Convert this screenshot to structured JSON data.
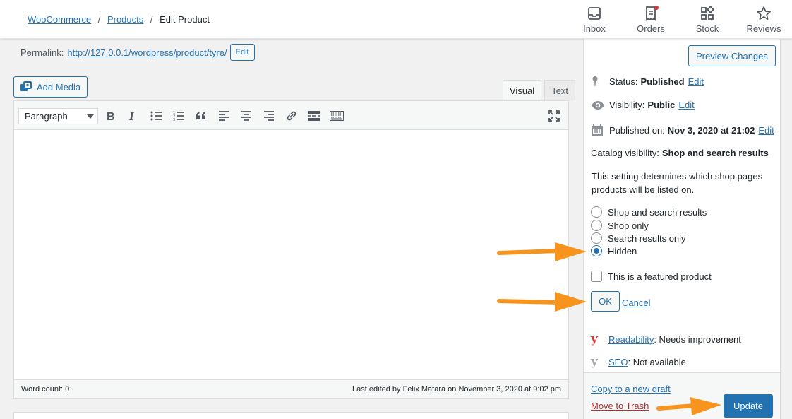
{
  "breadcrumb": {
    "woocommerce": "WooCommerce",
    "sep1": "/",
    "products": "Products",
    "sep2": "/",
    "current": "Edit Product"
  },
  "topnav": {
    "inbox": "Inbox",
    "orders": "Orders",
    "stock": "Stock",
    "reviews": "Reviews"
  },
  "permalink": {
    "label": "Permalink:",
    "url": "http://127.0.0.1/wordpress/product/tyre/",
    "edit": "Edit"
  },
  "editor": {
    "add_media": "Add Media",
    "tab_visual": "Visual",
    "tab_text": "Text",
    "format_select": "Paragraph",
    "word_count": "Word count: 0",
    "last_edited": "Last edited by Felix Matara on November 3, 2020 at 9:02 pm"
  },
  "publish": {
    "preview": "Preview Changes",
    "status_label": "Status:",
    "status_value": "Published",
    "status_edit": "Edit",
    "visibility_label": "Visibility:",
    "visibility_value": "Public",
    "visibility_edit": "Edit",
    "published_label": "Published on:",
    "published_value": "Nov 3, 2020 at 21:02",
    "published_edit": "Edit",
    "catalog_label": "Catalog visibility:",
    "catalog_value": "Shop and search results",
    "catalog_desc": "This setting determines which shop pages products will be listed on.",
    "options": [
      {
        "label": "Shop and search results",
        "checked": false
      },
      {
        "label": "Shop only",
        "checked": false
      },
      {
        "label": "Search results only",
        "checked": false
      },
      {
        "label": "Hidden",
        "checked": true
      }
    ],
    "featured": "This is a featured product",
    "ok": "OK",
    "cancel": "Cancel",
    "readability_link": "Readability",
    "readability_value": ": Needs improvement",
    "seo_link": "SEO",
    "seo_value": ": Not available",
    "copy_draft": "Copy to a new draft",
    "trash": "Move to Trash",
    "update": "Update"
  },
  "colors": {
    "accent": "#2271b1",
    "arrow": "#f7941d",
    "trash": "#b32d2e",
    "yoast_bad": "#dc3232"
  }
}
